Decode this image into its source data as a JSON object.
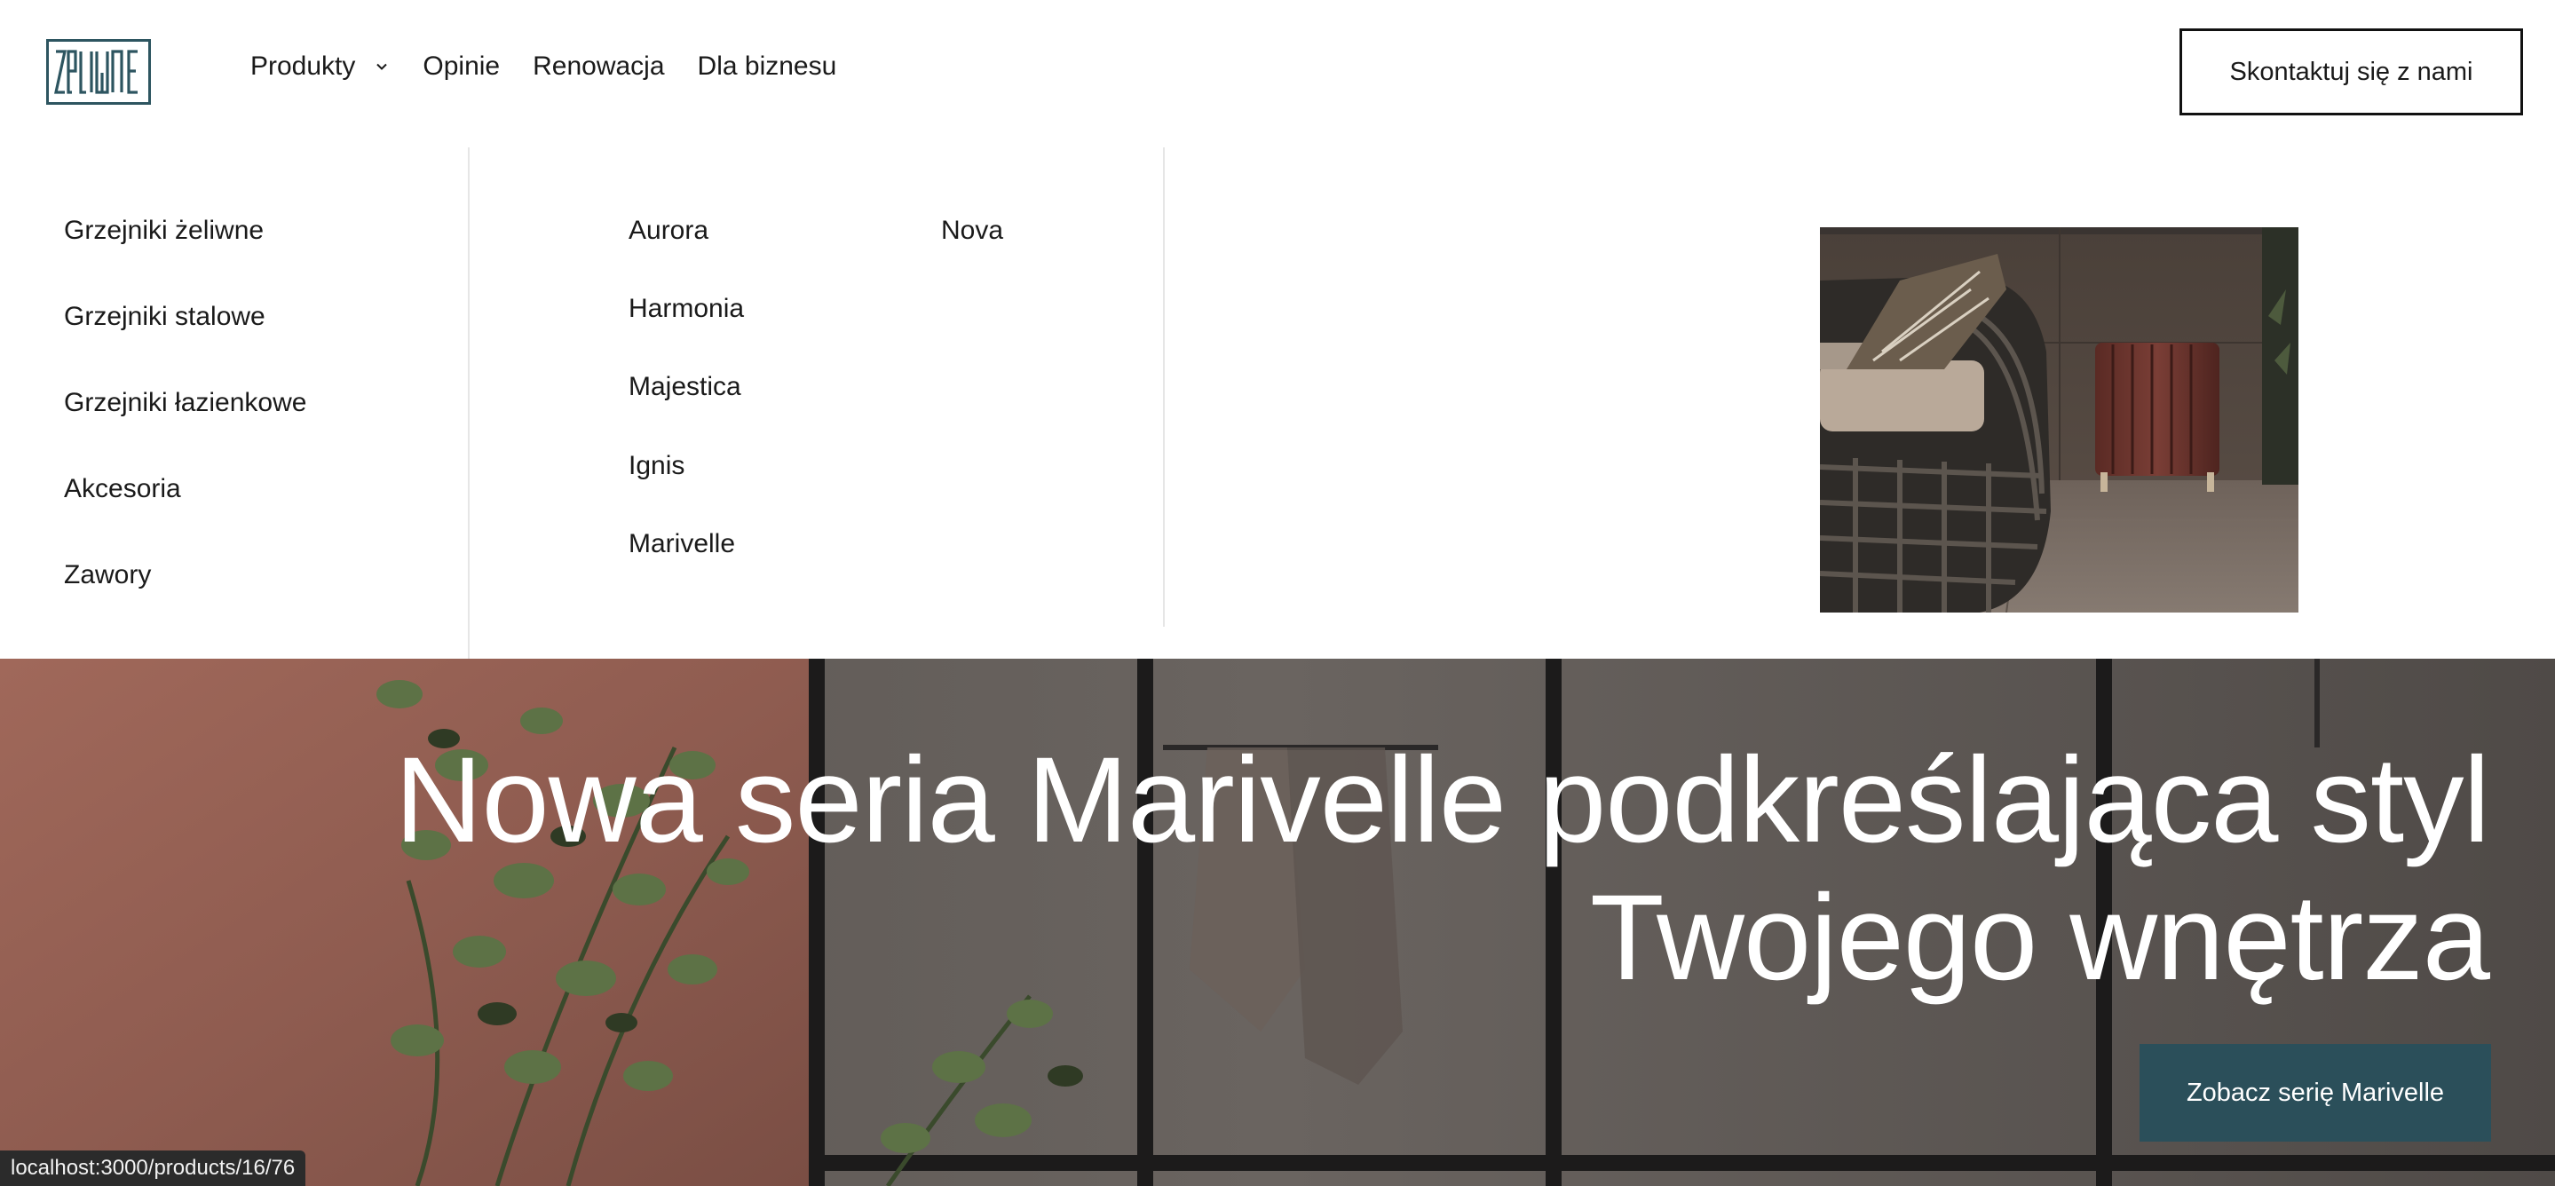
{
  "header": {
    "logo_text": "żeliwne",
    "nav": [
      {
        "label": "Produkty"
      },
      {
        "label": "Opinie"
      },
      {
        "label": "Renowacja"
      },
      {
        "label": "Dla biznesu"
      }
    ],
    "contact_button": "Skontaktuj się z nami"
  },
  "mega_menu": {
    "categories": [
      "Grzejniki żeliwne",
      "Grzejniki stalowe",
      "Grzejniki łazienkowe",
      "Akcesoria",
      "Zawory"
    ],
    "series_col1": [
      "Aurora",
      "Harmonia",
      "Majestica",
      "Ignis",
      "Marivelle"
    ],
    "series_col2": [
      "Nova"
    ]
  },
  "hero": {
    "title_line1": "Nowa seria Marivelle podkreślająca styl",
    "title_line2": "Twojego wnętrza",
    "cta": "Zobacz serię Marivelle"
  },
  "status_bar": {
    "url": "localhost:3000/products/16/76"
  },
  "colors": {
    "brand": "#2d5560",
    "cta": "#2b4f5a"
  }
}
